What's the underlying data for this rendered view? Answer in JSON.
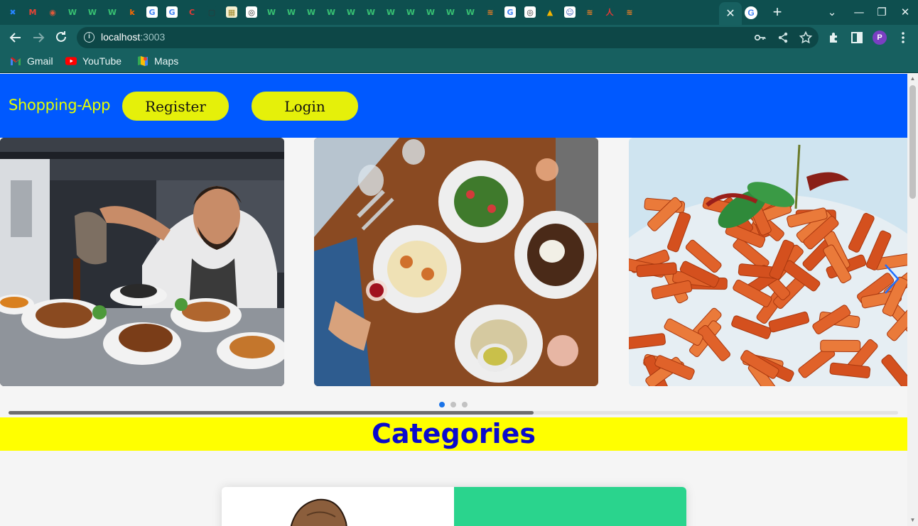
{
  "browser": {
    "tabs": [
      {
        "icon": "confluence-icon",
        "glyph": "✖",
        "bg": "#0e4f4f",
        "fg": "#2684ff"
      },
      {
        "icon": "gmail-icon",
        "glyph": "M",
        "bg": "#0e4f4f",
        "fg": "#ea4335"
      },
      {
        "icon": "globe-flag-icon",
        "glyph": "◉",
        "bg": "#0e4f4f",
        "fg": "#e05a3a"
      },
      {
        "icon": "w-icon",
        "glyph": "W",
        "bg": "#0e4f4f",
        "fg": "#38c172"
      },
      {
        "icon": "w-icon",
        "glyph": "W",
        "bg": "#0e4f4f",
        "fg": "#38c172"
      },
      {
        "icon": "w-icon",
        "glyph": "W",
        "bg": "#0e4f4f",
        "fg": "#38c172"
      },
      {
        "icon": "k-icon",
        "glyph": "k",
        "bg": "#0e4f4f",
        "fg": "#ff6a00"
      },
      {
        "icon": "google-icon",
        "glyph": "G",
        "bg": "#ffffff",
        "fg": "#4285f4"
      },
      {
        "icon": "google-icon",
        "glyph": "G",
        "bg": "#ffffff",
        "fg": "#4285f4"
      },
      {
        "icon": "c-icon",
        "glyph": "C",
        "bg": "#0e4f4f",
        "fg": "#e53935"
      },
      {
        "icon": "dark-tab-icon",
        "glyph": "▢",
        "bg": "#0e4f4f",
        "fg": "#2c3a3a"
      },
      {
        "icon": "image-icon",
        "glyph": "▦",
        "bg": "#f5f0d0",
        "fg": "#a08c30"
      },
      {
        "icon": "chrome-icon",
        "glyph": "◎",
        "bg": "#ffffff",
        "fg": "#333333"
      },
      {
        "icon": "w-icon",
        "glyph": "W",
        "bg": "#0e4f4f",
        "fg": "#38c172"
      },
      {
        "icon": "w-icon",
        "glyph": "W",
        "bg": "#0e4f4f",
        "fg": "#38c172"
      },
      {
        "icon": "w-icon",
        "glyph": "W",
        "bg": "#0e4f4f",
        "fg": "#38c172"
      },
      {
        "icon": "w-icon",
        "glyph": "W",
        "bg": "#0e4f4f",
        "fg": "#38c172"
      },
      {
        "icon": "w-icon",
        "glyph": "W",
        "bg": "#0e4f4f",
        "fg": "#38c172"
      },
      {
        "icon": "w-icon",
        "glyph": "W",
        "bg": "#0e4f4f",
        "fg": "#38c172"
      },
      {
        "icon": "w-icon",
        "glyph": "W",
        "bg": "#0e4f4f",
        "fg": "#38c172"
      },
      {
        "icon": "w-icon",
        "glyph": "W",
        "bg": "#0e4f4f",
        "fg": "#38c172"
      },
      {
        "icon": "w-icon",
        "glyph": "W",
        "bg": "#0e4f4f",
        "fg": "#38c172"
      },
      {
        "icon": "w-icon",
        "glyph": "W",
        "bg": "#0e4f4f",
        "fg": "#38c172"
      },
      {
        "icon": "w-icon",
        "glyph": "W",
        "bg": "#0e4f4f",
        "fg": "#38c172"
      },
      {
        "icon": "stackoverflow-icon",
        "glyph": "≋",
        "bg": "#0e4f4f",
        "fg": "#f48024"
      },
      {
        "icon": "google-icon",
        "glyph": "G",
        "bg": "#ffffff",
        "fg": "#4285f4"
      },
      {
        "icon": "chrome-icon",
        "glyph": "◎",
        "bg": "#ffffff",
        "fg": "#333333"
      },
      {
        "icon": "alert-icon",
        "glyph": "▲",
        "bg": "#0e4f4f",
        "fg": "#f4b400"
      },
      {
        "icon": "profile-photo-icon",
        "glyph": "☺",
        "bg": "#ffffff",
        "fg": "#3a5bb8"
      },
      {
        "icon": "stackoverflow-icon",
        "glyph": "≋",
        "bg": "#0e4f4f",
        "fg": "#f48024"
      },
      {
        "icon": "figure-icon",
        "glyph": "人",
        "bg": "#0e4f4f",
        "fg": "#e53935"
      },
      {
        "icon": "stackoverflow-icon",
        "glyph": "≋",
        "bg": "#0e4f4f",
        "fg": "#f48024"
      }
    ],
    "active_tab_close": "✕",
    "extra_tab_glyph": "G",
    "new_tab": "+",
    "tab_menu": "⌄",
    "minimize": "—",
    "maximize": "❐",
    "close": "✕",
    "url_host": "localhost",
    "url_port": ":3003",
    "profile_initial": "P",
    "bookmarks": [
      {
        "label": "Gmail",
        "icon": "gmail-icon"
      },
      {
        "label": "YouTube",
        "icon": "youtube-icon"
      },
      {
        "label": "Maps",
        "icon": "maps-icon"
      }
    ]
  },
  "page": {
    "brand": "Shopping-App",
    "register_label": "Register",
    "login_label": "Login",
    "carousel": {
      "slides": [
        "chef-serving-plates-photo",
        "restaurant-table-dishes-photo",
        "penne-pasta-photo"
      ],
      "active_dot": 0,
      "dot_count": 3,
      "scroll_progress": 0.59
    },
    "categories_title": "Categories"
  },
  "colors": {
    "navbar": "#0059ff",
    "brand_text": "#e5ff00",
    "button": "#e5f00a",
    "categories_bar": "#ffff00",
    "categories_text": "#0a0acc",
    "card_accent": "#2ad48d"
  }
}
